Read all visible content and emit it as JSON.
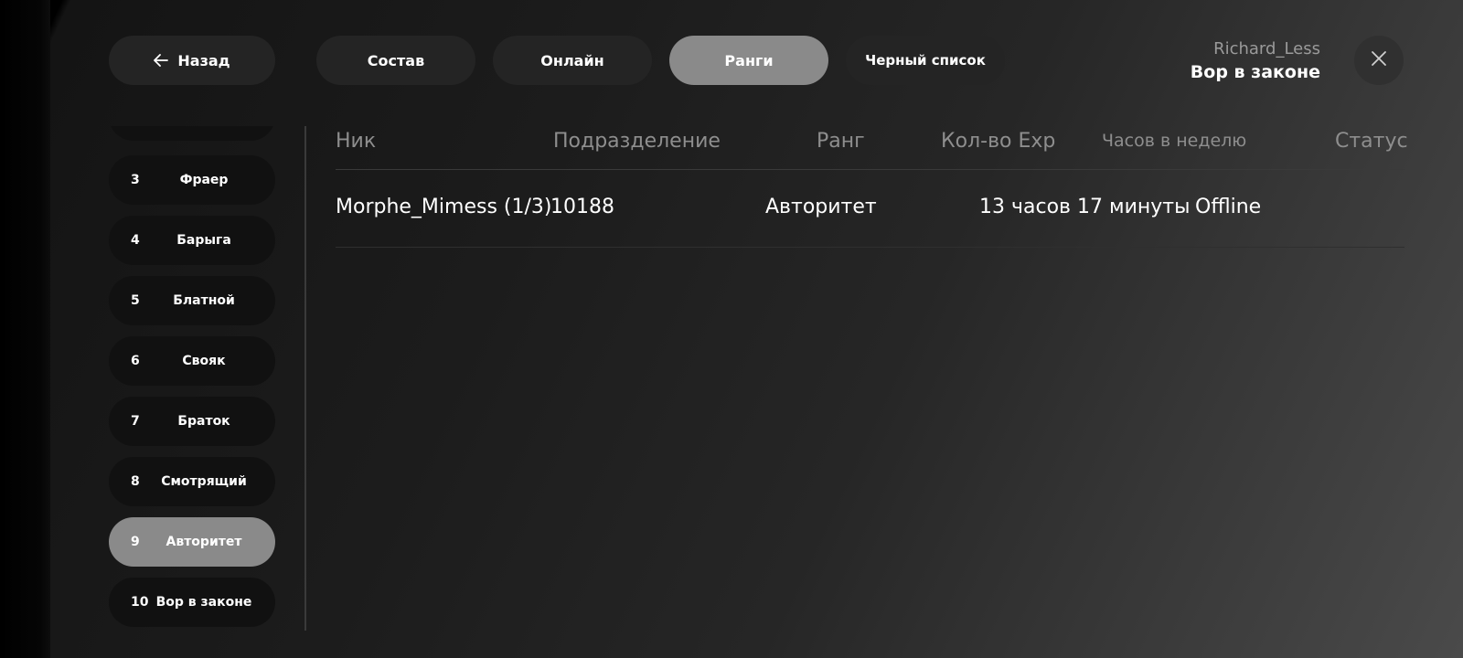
{
  "header": {
    "back_label": "Назад",
    "tabs": [
      {
        "label": "Состав"
      },
      {
        "label": "Онлайн"
      },
      {
        "label": "Ранги"
      },
      {
        "label": "Черный список"
      }
    ],
    "active_tab": "Ранги",
    "user": {
      "name": "Richard_Less",
      "rank": "Вор в законе"
    }
  },
  "sidebar": {
    "ranks": [
      {
        "num": "",
        "label": "",
        "active": false
      },
      {
        "num": "3",
        "label": "Фраер",
        "active": false
      },
      {
        "num": "4",
        "label": "Барыга",
        "active": false
      },
      {
        "num": "5",
        "label": "Блатной",
        "active": false
      },
      {
        "num": "6",
        "label": "Свояк",
        "active": false
      },
      {
        "num": "7",
        "label": "Браток",
        "active": false
      },
      {
        "num": "8",
        "label": "Смотрящий",
        "active": false
      },
      {
        "num": "9",
        "label": "Авторитет",
        "active": true
      },
      {
        "num": "10",
        "label": "Вор в законе",
        "active": false
      }
    ]
  },
  "table": {
    "columns": [
      "Ник",
      "Подразделение",
      "Ранг",
      "Кол-во Exp",
      "Часов в неделю",
      "Статус"
    ],
    "rows": [
      {
        "nick": "Morphe_Mimess (1/3)",
        "division": "10188",
        "rank": "Авторитет",
        "exp": "",
        "hours": "13 часов 17 минуты",
        "status": "Offline"
      }
    ]
  },
  "colors": {
    "pill_bg": "#242424",
    "pill_active": "#8a8a8a",
    "sidebar_item_bg": "#111111",
    "header_text": "#8e8e8e"
  }
}
